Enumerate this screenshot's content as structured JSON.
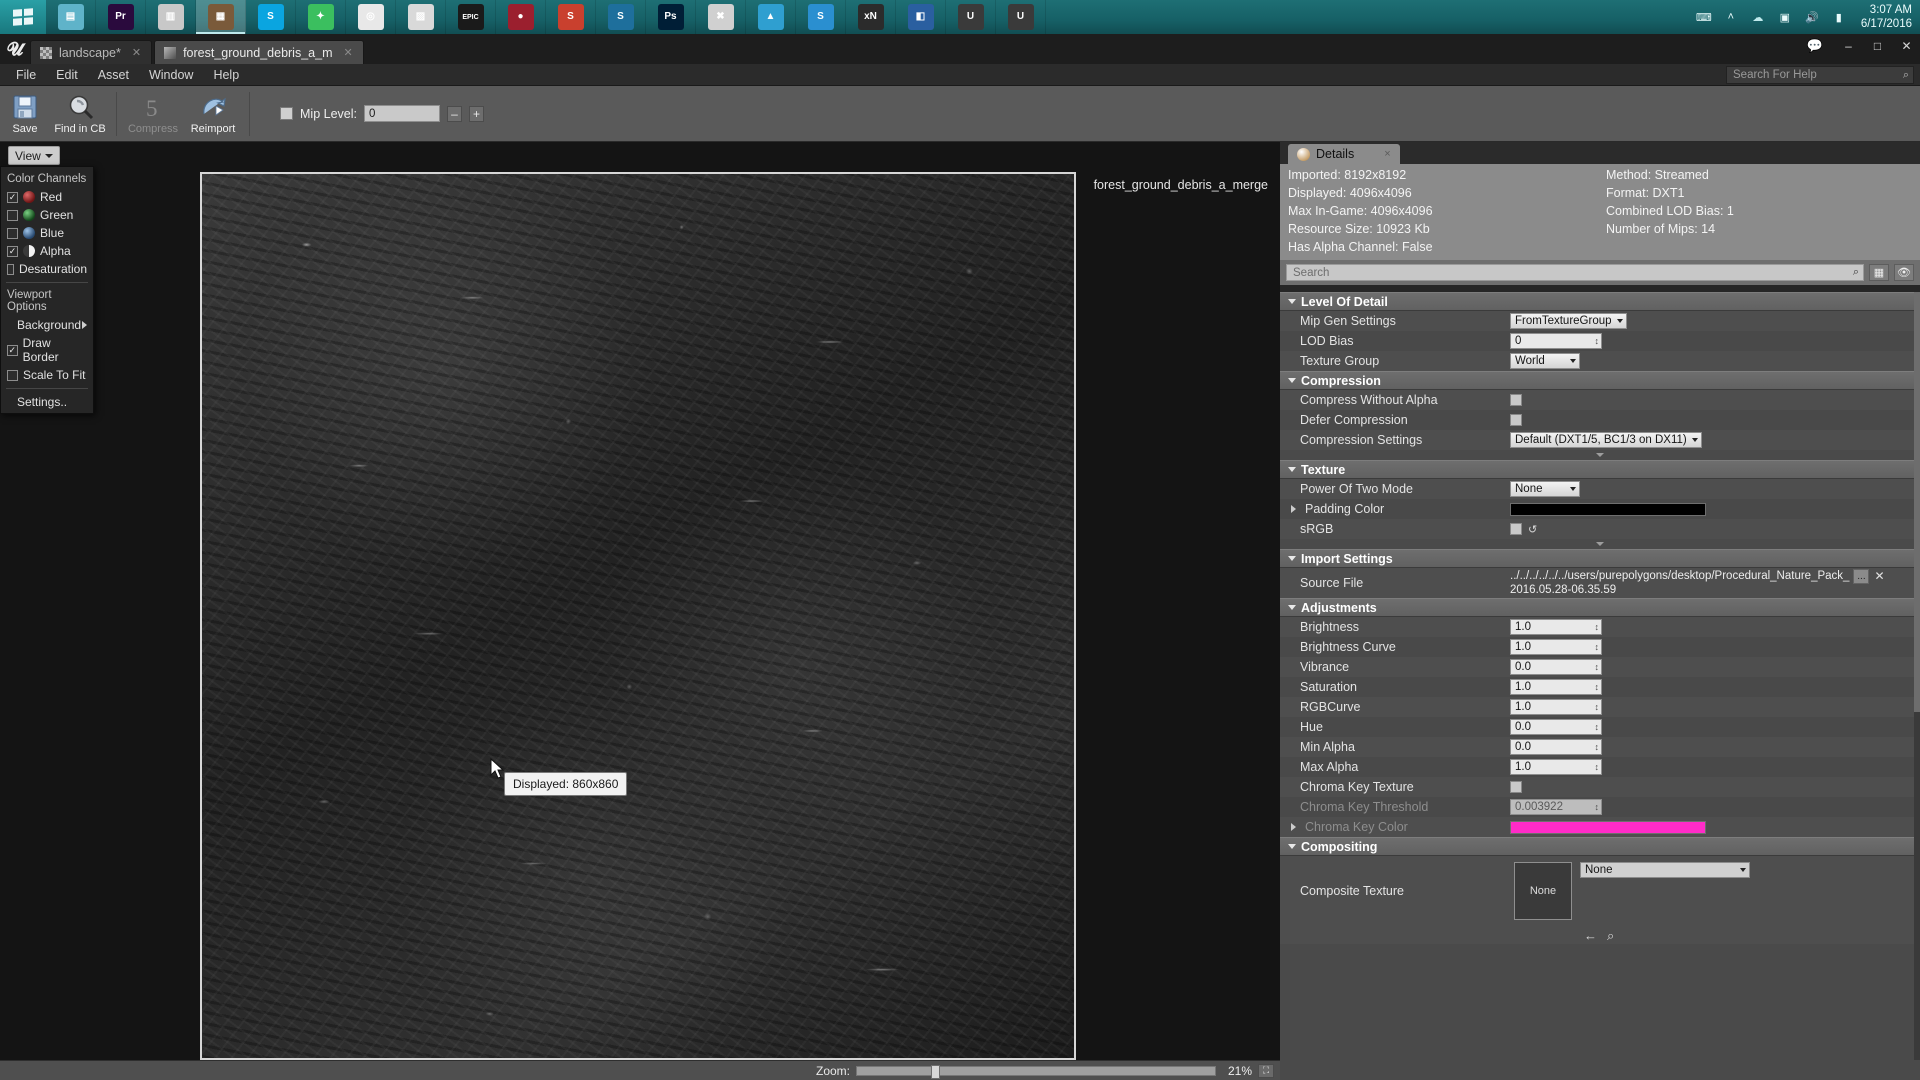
{
  "taskbar": {
    "start_icon": "windows-start-icon",
    "apps": [
      {
        "name": "explorer",
        "label": "",
        "color": "#5fb3c9",
        "glyph": "▤"
      },
      {
        "name": "premiere",
        "label": "Pr",
        "color": "#2a0a3d",
        "glyph": "Pr"
      },
      {
        "name": "file-manager",
        "label": "",
        "color": "#c8c8c8",
        "glyph": "▥"
      },
      {
        "name": "active-app",
        "label": "",
        "color": "#7a5a3a",
        "glyph": "▦"
      },
      {
        "name": "skype-blue",
        "label": "S",
        "color": "#0aa5e0",
        "glyph": "S"
      },
      {
        "name": "green-bolt",
        "label": "",
        "color": "#3bbf5f",
        "glyph": "✦"
      },
      {
        "name": "chrome",
        "label": "",
        "color": "#e8e8e8",
        "glyph": "◎"
      },
      {
        "name": "charts",
        "label": "",
        "color": "#d9d9d9",
        "glyph": "▨"
      },
      {
        "name": "epic-games",
        "label": "EPIC",
        "color": "#1a1a1a",
        "glyph": "EPIC"
      },
      {
        "name": "cherry-app",
        "label": "",
        "color": "#9b1f2e",
        "glyph": "●"
      },
      {
        "name": "substance-s1",
        "label": "S",
        "color": "#c9402e",
        "glyph": "S"
      },
      {
        "name": "substance-s2",
        "label": "S",
        "color": "#1e6f9c",
        "glyph": "S"
      },
      {
        "name": "photoshop",
        "label": "Ps",
        "color": "#001e36",
        "glyph": "Ps"
      },
      {
        "name": "body-paint",
        "label": "",
        "color": "#d0d0d0",
        "glyph": "✖"
      },
      {
        "name": "mountain-app",
        "label": "",
        "color": "#2f9fd0",
        "glyph": "▲"
      },
      {
        "name": "skype-s3",
        "label": "S",
        "color": "#2a8fd0",
        "glyph": "S"
      },
      {
        "name": "xnormal",
        "label": "xN",
        "color": "#2b2b2b",
        "glyph": "xN"
      },
      {
        "name": "blue-window",
        "label": "",
        "color": "#2a5fa0",
        "glyph": "◧"
      },
      {
        "name": "unreal-engine-1",
        "label": "",
        "color": "#3a3a3a",
        "glyph": "U"
      },
      {
        "name": "unreal-engine-2",
        "label": "",
        "color": "#3a3a3a",
        "glyph": "U"
      }
    ],
    "tray_icons": [
      "keyboard-icon",
      "chevron-up-icon",
      "cloud-icon",
      "onedrive-icon",
      "volume-icon",
      "network-icon"
    ],
    "clock_time": "3:07 AM",
    "clock_date": "6/17/2016"
  },
  "window": {
    "logo": "unreal-logo-icon",
    "tabs": [
      {
        "label": "landscape*",
        "icon": "level-icon",
        "active": false
      },
      {
        "label": "forest_ground_debris_a_m",
        "icon": "texture-icon",
        "active": true
      }
    ],
    "chat_icon": "chat-icon",
    "controls": {
      "minimize": "–",
      "maximize": "□",
      "close": "✕"
    }
  },
  "menubar": {
    "items": [
      "File",
      "Edit",
      "Asset",
      "Window",
      "Help"
    ],
    "search_placeholder": "Search For Help",
    "search_icon": "search-icon"
  },
  "toolbar": {
    "buttons": [
      {
        "name": "save-button",
        "label": "Save",
        "icon": "floppy-disk-icon",
        "disabled": false
      },
      {
        "name": "find-in-cb-button",
        "label": "Find in CB",
        "icon": "magnifier-icon",
        "disabled": false
      },
      {
        "name": "compress-button",
        "label": "Compress",
        "icon": "compress-icon",
        "disabled": true
      },
      {
        "name": "reimport-button",
        "label": "Reimport",
        "icon": "reimport-icon",
        "disabled": false
      }
    ],
    "mip_checkbox_checked": false,
    "mip_label": "Mip Level:",
    "mip_value": "0",
    "mip_minus": "–",
    "mip_plus": "+"
  },
  "viewport": {
    "view_button_label": "View",
    "view_menu": {
      "color_channels_header": "Color Channels",
      "channels": [
        {
          "label": "Red",
          "checked": true,
          "color": "#a83a3a"
        },
        {
          "label": "Green",
          "checked": false,
          "color": "#3f8f45"
        },
        {
          "label": "Blue",
          "checked": false,
          "color": "#4a7bb5"
        },
        {
          "label": "Alpha",
          "checked": true,
          "color": "#d8d8d8"
        }
      ],
      "desaturation": {
        "label": "Desaturation",
        "checked": false
      },
      "viewport_options_header": "Viewport Options",
      "background_label": "Background",
      "draw_border": {
        "label": "Draw Border",
        "checked": true
      },
      "scale_to_fit": {
        "label": "Scale To Fit",
        "checked": false
      },
      "settings_label": "Settings.."
    },
    "texture_name": "forest_ground_debris_a_merge",
    "tooltip": "Displayed: 860x860",
    "zoom_label": "Zoom:",
    "zoom_value": "21%",
    "zoom_fit_icon": "fit-to-screen-icon",
    "zoom_slider_percent": 21
  },
  "details": {
    "tab_label": "Details",
    "tab_icon": "details-info-icon",
    "tab_close": "×",
    "info": [
      {
        "left": "Imported: 8192x8192",
        "right": "Method: Streamed"
      },
      {
        "left": "Displayed: 4096x4096",
        "right": "Format: DXT1"
      },
      {
        "left": "Max In-Game: 4096x4096",
        "right": "Combined LOD Bias: 1"
      },
      {
        "left": "Resource Size: 10923 Kb",
        "right": "Number of Mips: 14"
      },
      {
        "left": "Has Alpha Channel: False",
        "right": ""
      }
    ],
    "search_placeholder": "Search",
    "search_icon": "search-icon",
    "filter_icon": "filter-grid-icon",
    "visibility_icon": "eye-icon",
    "categories": [
      {
        "name": "Level Of Detail",
        "rows": [
          {
            "label": "Mip Gen Settings",
            "type": "combo",
            "value": "FromTextureGroup"
          },
          {
            "label": "LOD Bias",
            "type": "number",
            "value": "0"
          },
          {
            "label": "Texture Group",
            "type": "combo",
            "value": "World"
          }
        ]
      },
      {
        "name": "Compression",
        "rows": [
          {
            "label": "Compress Without Alpha",
            "type": "checkbox",
            "value": false
          },
          {
            "label": "Defer Compression",
            "type": "checkbox",
            "value": false
          },
          {
            "label": "Compression Settings",
            "type": "combo",
            "value": "Default (DXT1/5, BC1/3 on DX11)"
          }
        ]
      },
      {
        "name": "Texture",
        "rows": [
          {
            "label": "Power Of Two Mode",
            "type": "combo",
            "value": "None"
          },
          {
            "label": "Padding Color",
            "type": "color",
            "value": "#000000",
            "expandable": true
          },
          {
            "label": "sRGB",
            "type": "checkbox",
            "value": false,
            "reset": true
          }
        ]
      },
      {
        "name": "Import Settings",
        "rows": [
          {
            "label": "Source File",
            "type": "path",
            "value": "../../../../../../users/purepolygons/desktop/Procedural_Nature_Pack_",
            "value2": "2016.05.28-06.35.59",
            "browse": "...",
            "clear": "✕"
          }
        ]
      },
      {
        "name": "Adjustments",
        "rows": [
          {
            "label": "Brightness",
            "type": "number",
            "value": "1.0"
          },
          {
            "label": "Brightness Curve",
            "type": "number",
            "value": "1.0"
          },
          {
            "label": "Vibrance",
            "type": "number",
            "value": "0.0"
          },
          {
            "label": "Saturation",
            "type": "number",
            "value": "1.0"
          },
          {
            "label": "RGBCurve",
            "type": "number",
            "value": "1.0"
          },
          {
            "label": "Hue",
            "type": "number",
            "value": "0.0"
          },
          {
            "label": "Min Alpha",
            "type": "number",
            "value": "0.0"
          },
          {
            "label": "Max Alpha",
            "type": "number",
            "value": "1.0"
          },
          {
            "label": "Chroma Key Texture",
            "type": "checkbox",
            "value": false
          },
          {
            "label": "Chroma Key Threshold",
            "type": "number",
            "value": "0.003922",
            "dim": true
          },
          {
            "label": "Chroma Key Color",
            "type": "color",
            "value": "#ff2bc8",
            "expandable": true,
            "dim": true
          }
        ]
      },
      {
        "name": "Compositing",
        "rows": [
          {
            "label": "Composite Texture",
            "type": "asset",
            "thumb_label": "None",
            "value": "None",
            "back_icon": "back-arrow-icon",
            "browse_icon": "browse-magnifier-icon"
          }
        ]
      }
    ]
  }
}
